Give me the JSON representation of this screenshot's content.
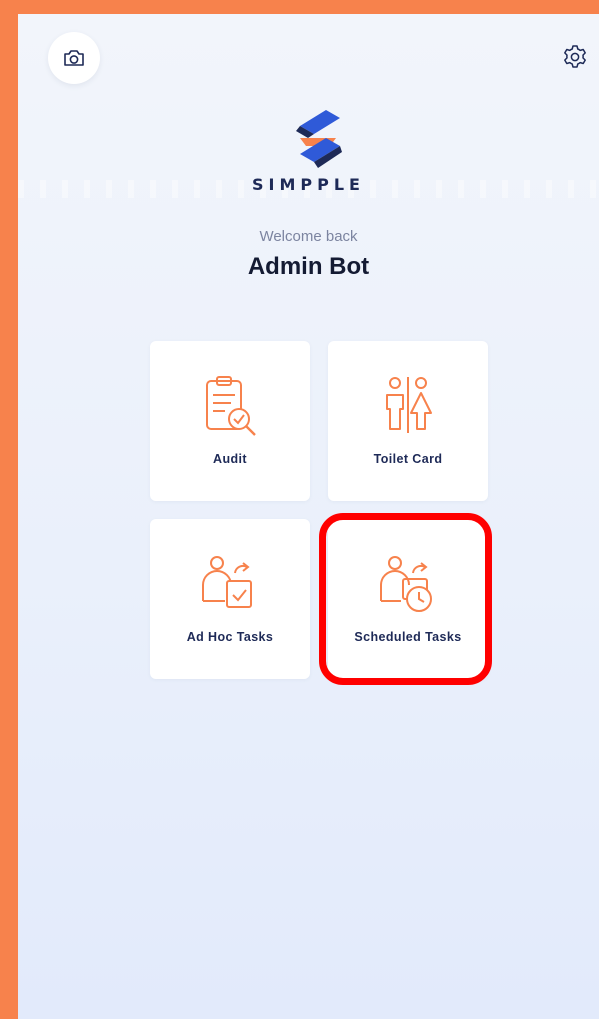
{
  "header": {
    "camera_icon": "camera-icon",
    "settings_icon": "gear-icon"
  },
  "brand": {
    "name": "SIMPPLE",
    "colors": {
      "navy": "#1e2a57",
      "blue": "#2f5ad8",
      "orange": "#f7824c"
    }
  },
  "welcome": {
    "greeting": "Welcome back",
    "user_name": "Admin Bot"
  },
  "tiles": [
    {
      "label": "Audit",
      "icon": "clipboard-search-icon"
    },
    {
      "label": "Toilet Card",
      "icon": "restroom-icon"
    },
    {
      "label": "Ad Hoc Tasks",
      "icon": "person-task-icon"
    },
    {
      "label": "Scheduled Tasks",
      "icon": "person-clock-icon"
    }
  ],
  "highlight": {
    "target": "Scheduled Tasks",
    "color": "#ff0000"
  },
  "theme": {
    "accent": "#f7824c",
    "background": "#eef2fb",
    "tile": "#ffffff"
  }
}
